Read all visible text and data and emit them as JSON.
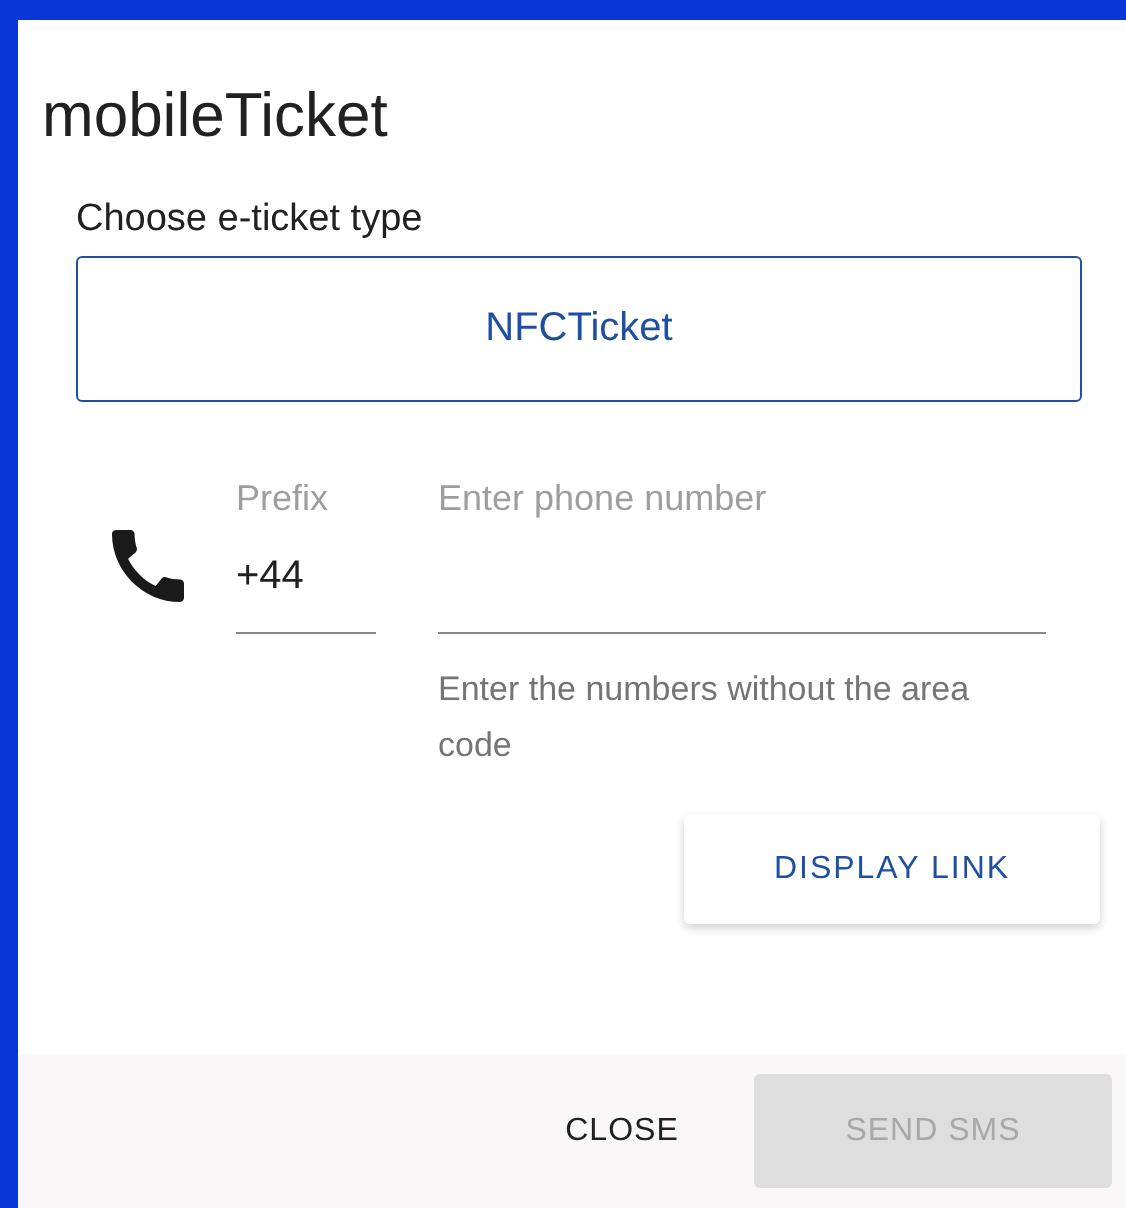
{
  "dialog": {
    "title": "mobileTicket"
  },
  "ticket_type": {
    "label": "Choose e-ticket type",
    "value": "NFCTicket"
  },
  "prefix": {
    "label": "Prefix",
    "value": "+44"
  },
  "phone": {
    "placeholder": "Enter phone number",
    "helper": "Enter the numbers without the area code"
  },
  "display_link": {
    "label": "DISPLAY LINK"
  },
  "actions": [
    {
      "label": "CLOSE",
      "kind": "text",
      "disabled": false
    },
    {
      "label": "SEND SMS",
      "kind": "contained",
      "disabled": true
    }
  ]
}
